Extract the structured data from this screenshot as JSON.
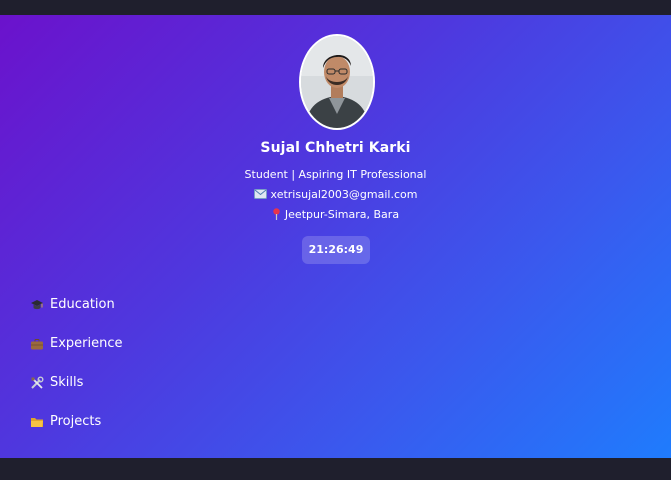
{
  "profile": {
    "name": "Sujal Chhetri Karki",
    "role": "Student | Aspiring IT Professional",
    "email": "xetrisujal2003@gmail.com",
    "location": "Jeetpur-Simara, Bara",
    "photo_icon": "profile-photo"
  },
  "clock": {
    "time": "21:26:49"
  },
  "nav": {
    "items": [
      {
        "label": "Education",
        "icon": "graduation-cap-icon"
      },
      {
        "label": "Experience",
        "icon": "briefcase-icon"
      },
      {
        "label": "Skills",
        "icon": "tools-icon"
      },
      {
        "label": "Projects",
        "icon": "folder-icon"
      }
    ]
  },
  "colors": {
    "gradient_start": "#6b12cc",
    "gradient_end": "#1f7cfd",
    "frame": "#1f1f2d",
    "text": "#ffffff"
  }
}
